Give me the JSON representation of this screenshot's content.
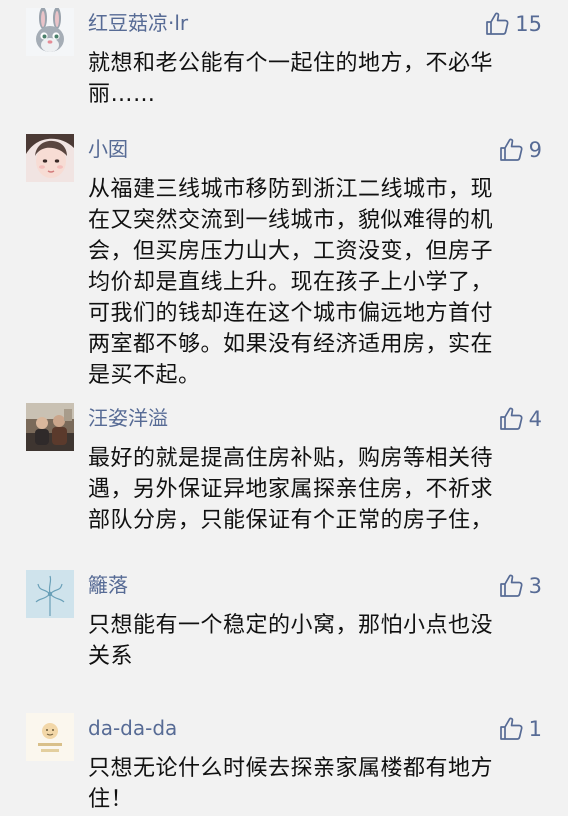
{
  "comments": [
    {
      "author": "红豆菇凉·lr",
      "likes": "15",
      "avatar": "rabbit-avatar",
      "lines": [
        "就想和老公能有个一起住的地方，不必华",
        "丽……"
      ]
    },
    {
      "author": "小囡",
      "likes": "9",
      "avatar": "girl-avatar",
      "lines": [
        "从福建三线城市移防到浙江二线城市，现",
        "在又突然交流到一线城市，貌似难得的机",
        "会，但买房压力山大，工资没变，但房子",
        "均价却是直线上升。现在孩子上小学了，",
        "可我们的钱却连在这个城市偏远地方首付",
        "两室都不够。如果没有经济适用房，实在",
        "是买不起。"
      ]
    },
    {
      "author": "汪姿洋溢",
      "likes": "4",
      "avatar": "people-photo-avatar",
      "lines": [
        "最好的就是提高住房补贴，购房等相关待",
        "遇，另外保证异地家属探亲住房，不祈求",
        "部队分房，只能保证有个正常的房子住，"
      ]
    },
    {
      "author": "籬落",
      "likes": "3",
      "avatar": "flower-sketch-avatar",
      "lines": [
        "只想能有一个稳定的小窝，那怕小点也没",
        "关系"
      ]
    },
    {
      "author": "da-da-da",
      "likes": "1",
      "avatar": "cartoon-avatar",
      "lines": [
        "只想无论什么时候去探亲家属楼都有地方",
        "住！"
      ]
    }
  ]
}
